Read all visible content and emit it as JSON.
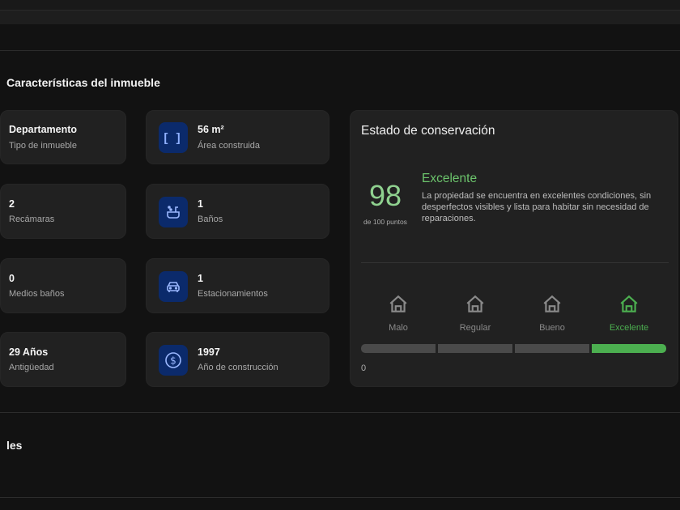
{
  "section_title": "Características del inmueble",
  "next_section_title": "les",
  "left_cards": [
    {
      "value": "Departamento",
      "label": "Tipo de inmueble"
    },
    {
      "value": "2",
      "label": "Recámaras"
    },
    {
      "value": "0",
      "label": "Medios baños"
    },
    {
      "value": "29 Años",
      "label": "Antigüedad"
    }
  ],
  "mid_cards": [
    {
      "value": "56 m²",
      "label": "Área construida",
      "icon": "area-bracket-icon"
    },
    {
      "value": "1",
      "label": "Baños",
      "icon": "bathtub-icon"
    },
    {
      "value": "1",
      "label": "Estacionamientos",
      "icon": "car-icon"
    },
    {
      "value": "1997",
      "label": "Año de construcción",
      "icon": "dollar-circle-icon"
    }
  ],
  "conservation": {
    "title": "Estado de conservación",
    "score": "98",
    "score_caption": "de 100 puntos",
    "rating": "Excelente",
    "description_lines": [
      "La propiedad se encuentra en excelentes condiciones, sin",
      "desperfectos visibles y lista para habitar sin necesidad de",
      "reparaciones."
    ],
    "levels": [
      "Malo",
      "Regular",
      "Bueno",
      "Excelente"
    ],
    "active_level": "Excelente",
    "scale_min": "0",
    "colors": {
      "accent": "#4caf50",
      "score": "#8fd18f",
      "inactive": "#4a4a4a",
      "icon_bg": "#0b2a6b"
    }
  }
}
